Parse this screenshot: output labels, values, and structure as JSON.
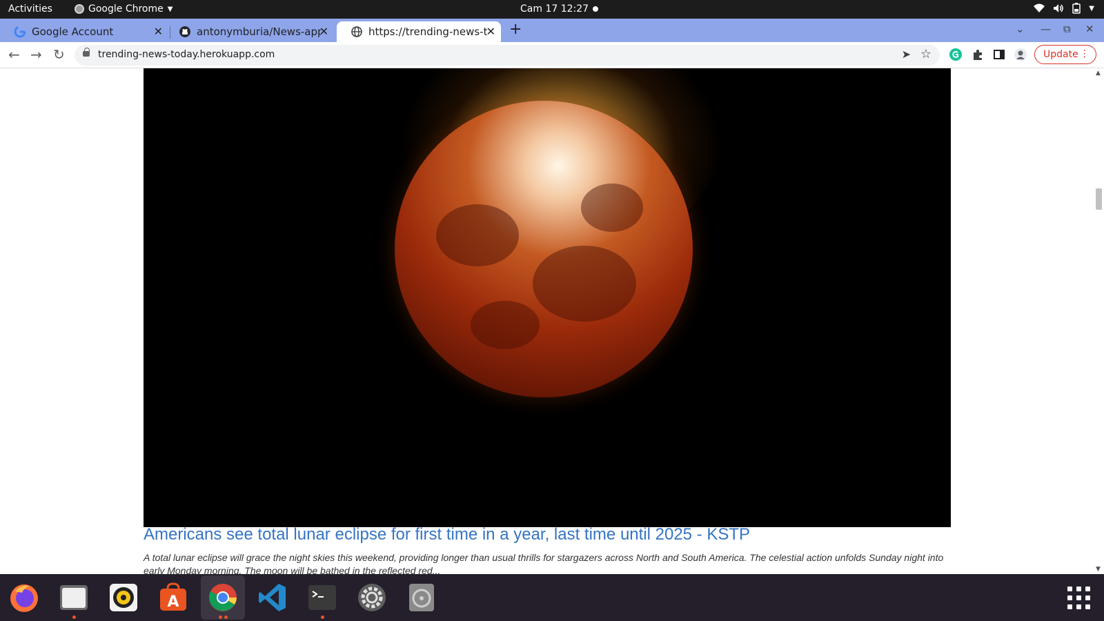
{
  "topbar": {
    "activities": "Activities",
    "app_name": "Google Chrome",
    "clock": "Cam 17  12:27"
  },
  "tabs": [
    {
      "title": "Google Account",
      "icon": "google-icon",
      "active": false
    },
    {
      "title": "antonymburia/News-app:",
      "icon": "github-icon",
      "active": false
    },
    {
      "title": "https://trending-news-to",
      "icon": "globe-icon",
      "active": true
    }
  ],
  "toolbar": {
    "url": "trending-news-today.herokuapp.com",
    "update_label": "Update"
  },
  "article": {
    "headline": "Americans see total lunar eclipse for first time in a year, last time until 2025 - KSTP",
    "description": "A total lunar eclipse will grace the night skies this weekend, providing longer than usual thrills for stargazers across North and South America. The celestial action unfolds Sunday night into early Monday morning. The moon will be bathed in the reflected red..."
  },
  "dock": {
    "apps": [
      "firefox-icon",
      "files-icon",
      "rhythmbox-icon",
      "software-icon",
      "chrome-icon",
      "vscode-icon",
      "terminal-icon",
      "settings-icon",
      "disc-icon"
    ],
    "running": [
      "files-icon",
      "chrome-icon",
      "terminal-icon"
    ],
    "active": "chrome-icon"
  },
  "colors": {
    "tabstrip": "#8ea5ea",
    "link": "#3474c4",
    "update": "#d93025",
    "dock": "#241f2b"
  }
}
